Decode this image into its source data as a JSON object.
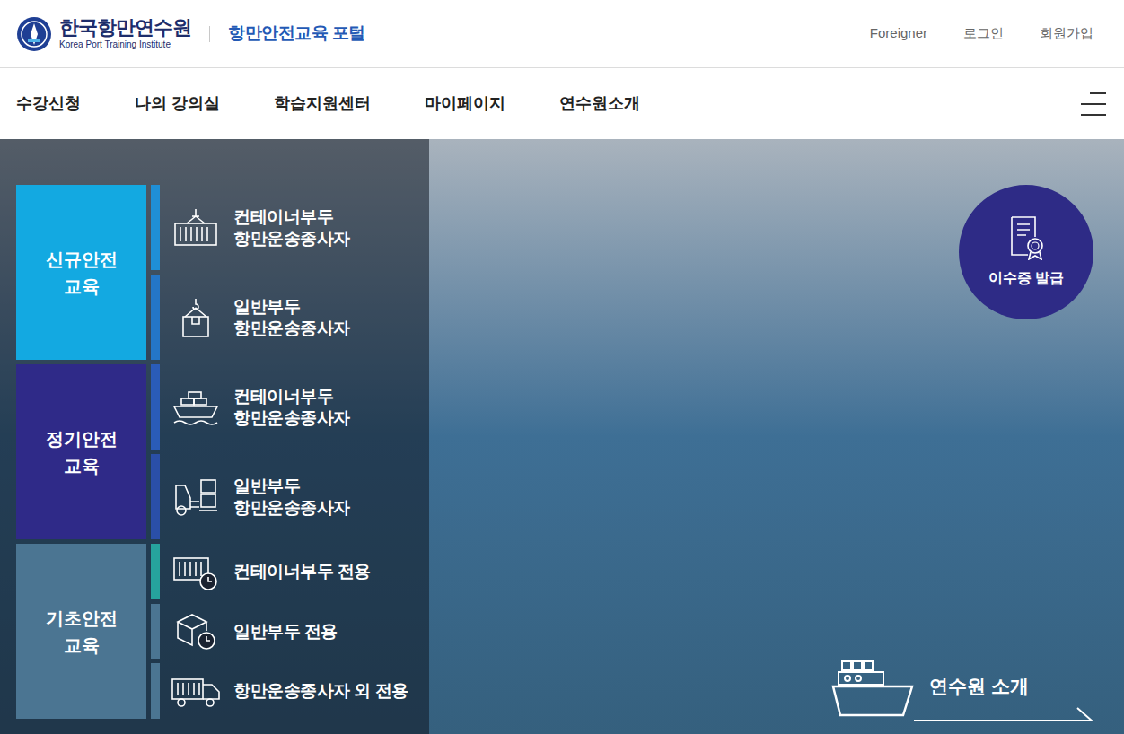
{
  "header": {
    "logo": {
      "name": "한국항만연수원",
      "subtitle": "Korea Port Training Institute"
    },
    "portal": "항만안전교육 포털",
    "links": [
      "Foreigner",
      "로그인",
      "회원가입"
    ]
  },
  "nav": {
    "items": [
      "수강신청",
      "나의 강의실",
      "학습지원센터",
      "마이페이지",
      "연수원소개"
    ]
  },
  "categories": [
    {
      "label": [
        "신규안전",
        "교육"
      ],
      "color": "#13a9e1",
      "items": [
        {
          "label": [
            "컨테이너부두",
            "항만운송종사자"
          ]
        },
        {
          "label": [
            "일반부두",
            "항만운송종사자"
          ]
        }
      ]
    },
    {
      "label": [
        "정기안전",
        "교육"
      ],
      "color": "#2f2a88",
      "items": [
        {
          "label": [
            "컨테이너부두",
            "항만운송종사자"
          ]
        },
        {
          "label": [
            "일반부두",
            "항만운송종사자"
          ]
        }
      ]
    },
    {
      "label": [
        "기초안전",
        "교육"
      ],
      "color": "#4b7592",
      "items": [
        {
          "label": [
            "컨테이너부두 전용"
          ]
        },
        {
          "label": [
            "일반부두 전용"
          ]
        },
        {
          "label": [
            "항만운송종사자 외 전용"
          ]
        }
      ]
    }
  ],
  "badge": "이수증 발급",
  "intro": "연수원 소개"
}
